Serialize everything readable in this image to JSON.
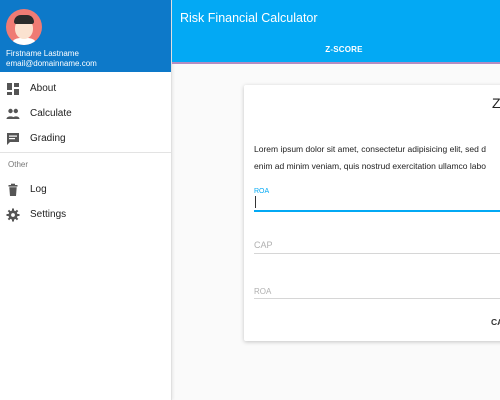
{
  "drawer": {
    "profile": {
      "name": "Firstname Lastname",
      "email": "email@domainname.com",
      "header_color": "#0d79c9"
    },
    "items": [
      {
        "label": "About",
        "icon": "dashboard-icon"
      },
      {
        "label": "Calculate",
        "icon": "people-icon"
      },
      {
        "label": "Grading",
        "icon": "chat-icon"
      }
    ],
    "subheader": "Other",
    "other_items": [
      {
        "label": "Log",
        "icon": "trash-icon"
      },
      {
        "label": "Settings",
        "icon": "gear-icon"
      }
    ]
  },
  "appbar": {
    "title": "Risk Financial Calculator",
    "color": "#03a9f4",
    "tabs": [
      {
        "label": "Z-SCORE",
        "active": true
      }
    ]
  },
  "card": {
    "title": "Z",
    "description_line1": "Lorem ipsum dolor sit amet, consectetur adipisicing elit, sed d",
    "description_line2": "enim ad minim veniam, quis nostrud exercitation ullamco labo",
    "fields": [
      {
        "label": "ROA",
        "value": "",
        "focused": true
      },
      {
        "label": "CAP",
        "value": "",
        "focused": false
      },
      {
        "label": "ROA",
        "value": "",
        "focused": false
      }
    ],
    "button_label": "CA",
    "accent_color": "#03a9f4"
  }
}
